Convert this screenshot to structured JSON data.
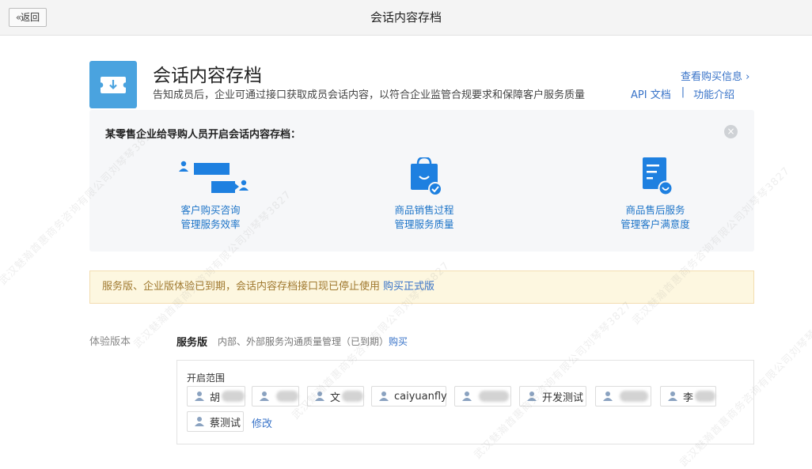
{
  "header": {
    "back_label": "返回",
    "title": "会话内容存档"
  },
  "app": {
    "title": "会话内容存档",
    "description": "告知成员后，企业可通过接口获取成员会话内容，以符合企业监管合规要求和保障客户服务质量",
    "buy_info_label": "查看购买信息 ›",
    "api_doc_label": "API 文档",
    "feature_intro_label": "功能介绍",
    "separator": "|"
  },
  "example": {
    "title": "某零售企业给导购人员开启会话内容存档：",
    "close_symbol": "×",
    "features": [
      {
        "line1": "客户购买咨询",
        "line2": "管理服务效率"
      },
      {
        "line1": "商品销售过程",
        "line2": "管理服务质量"
      },
      {
        "line1": "商品售后服务",
        "line2": "管理客户满意度"
      }
    ]
  },
  "notice": {
    "text": "服务版、企业版体验已到期，会话内容存档接口现已停止使用",
    "link": "购买正式版"
  },
  "version": {
    "label": "体验版本",
    "name": "服务版",
    "desc": "内部、外部服务沟通质量管理（已到期）",
    "buy_label": "购买"
  },
  "scope": {
    "label": "开启范围",
    "members": [
      "胡",
      "",
      "文",
      "caiyuanfly",
      "",
      "开发测试",
      "",
      "李",
      "蔡测试"
    ],
    "edit_label": "修改"
  },
  "watermark": "武汉魅瀚酋惠商务咨询有限公司刘琴琴3827",
  "colors": {
    "accent": "#3873c8",
    "icon_blue": "#1e80e0",
    "app_icon_bg": "#4aa3df",
    "notice_bg": "#fdf7e0",
    "notice_text": "#a0792f"
  }
}
